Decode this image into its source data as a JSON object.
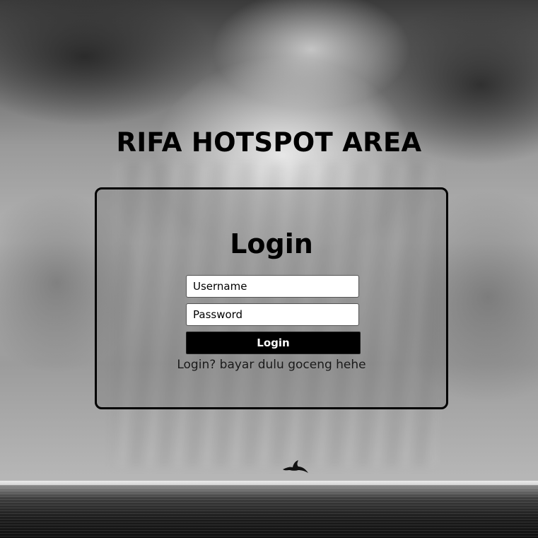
{
  "page": {
    "title": "RIFA HOTSPOT AREA"
  },
  "login_form": {
    "heading": "Login",
    "username": {
      "value": "",
      "placeholder": "Username"
    },
    "password": {
      "value": "",
      "placeholder": "Password"
    },
    "submit_label": "Login",
    "note": "Login? bayar dulu goceng hehe"
  },
  "colors": {
    "card_border": "#000000",
    "button_bg": "#000000",
    "button_text": "#ffffff"
  },
  "icons": {
    "background_bird": "bird-icon"
  }
}
